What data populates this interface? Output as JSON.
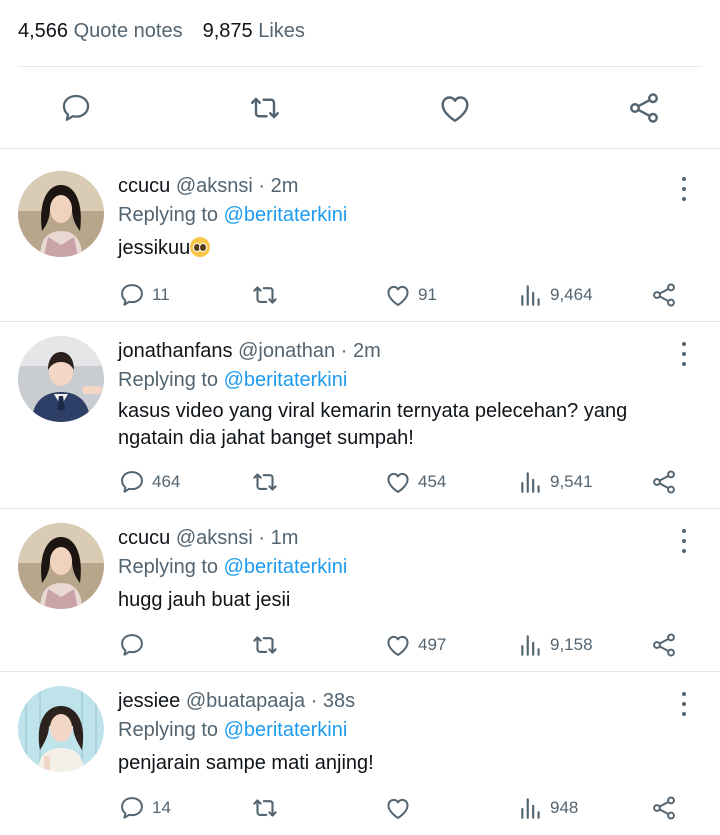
{
  "stats": {
    "quotes_count": "4,566",
    "quotes_label": "Quote notes",
    "likes_count": "9,875",
    "likes_label": "Likes"
  },
  "colors": {
    "text": "#0f1419",
    "muted": "#536471",
    "link": "#1d9bf0",
    "divider": "#e6e9eb"
  },
  "action_bar": [
    "reply-icon",
    "retweet-icon",
    "like-icon",
    "share-icon"
  ],
  "replies": [
    {
      "name": "ccucu",
      "handle": "@aksnsi",
      "sep": "·",
      "time": "2m",
      "replying_prefix": "Replying to",
      "replying_to": "@beritaterkini",
      "text": "jessikuu",
      "emoji": "pleading-face",
      "reply_count": "11",
      "retweet_count": "",
      "like_count": "91",
      "view_count": "9,464"
    },
    {
      "name": "jonathanfans",
      "handle": "@jonathan",
      "sep": "·",
      "time": "2m",
      "replying_prefix": "Replying to",
      "replying_to": "@beritaterkini",
      "text": "kasus video yang viral kemarin ternyata pelecehan? yang ngatain dia jahat banget sumpah!",
      "reply_count": "464",
      "retweet_count": "",
      "like_count": "454",
      "view_count": "9,541"
    },
    {
      "name": "ccucu",
      "handle": "@aksnsi",
      "sep": "·",
      "time": "1m",
      "replying_prefix": "Replying to",
      "replying_to": "@beritaterkini",
      "text": "hugg jauh buat jesii",
      "reply_count": "",
      "retweet_count": "",
      "like_count": "497",
      "view_count": "9,158"
    },
    {
      "name": "jessiee",
      "handle": "@buatapaaja",
      "sep": "·",
      "time": "38s",
      "replying_prefix": "Replying to",
      "replying_to": "@beritaterkini",
      "text": "penjarain sampe mati anjing!",
      "reply_count": "14",
      "retweet_count": "",
      "like_count": "",
      "view_count": "948"
    }
  ]
}
